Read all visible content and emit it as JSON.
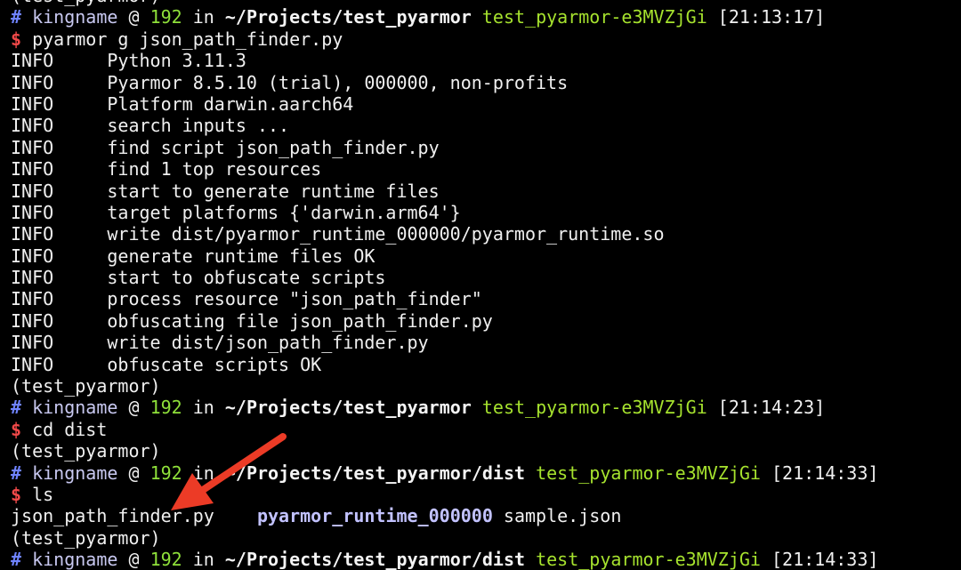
{
  "terminal": {
    "lines": [
      {
        "kind": "output",
        "text": "(test_pyarmor)"
      },
      {
        "kind": "prompt",
        "user": "kingname",
        "host": "192",
        "path": "~/Projects/test_pyarmor",
        "env": "test_pyarmor-e3MVZjGi",
        "time": "[21:13:17]"
      },
      {
        "kind": "command",
        "text": "pyarmor g json_path_finder.py"
      },
      {
        "kind": "output",
        "text": "INFO     Python 3.11.3"
      },
      {
        "kind": "output",
        "text": "INFO     Pyarmor 8.5.10 (trial), 000000, non-profits"
      },
      {
        "kind": "output",
        "text": "INFO     Platform darwin.aarch64"
      },
      {
        "kind": "output",
        "text": "INFO     search inputs ..."
      },
      {
        "kind": "output",
        "text": "INFO     find script json_path_finder.py"
      },
      {
        "kind": "output",
        "text": "INFO     find 1 top resources"
      },
      {
        "kind": "output",
        "text": "INFO     start to generate runtime files"
      },
      {
        "kind": "output",
        "text": "INFO     target platforms {'darwin.arm64'}"
      },
      {
        "kind": "output",
        "text": "INFO     write dist/pyarmor_runtime_000000/pyarmor_runtime.so"
      },
      {
        "kind": "output",
        "text": "INFO     generate runtime files OK"
      },
      {
        "kind": "output",
        "text": "INFO     start to obfuscate scripts"
      },
      {
        "kind": "output",
        "text": "INFO     process resource \"json_path_finder\""
      },
      {
        "kind": "output",
        "text": "INFO     obfuscating file json_path_finder.py"
      },
      {
        "kind": "output",
        "text": "INFO     write dist/json_path_finder.py"
      },
      {
        "kind": "output",
        "text": "INFO     obfuscate scripts OK"
      },
      {
        "kind": "output",
        "text": "(test_pyarmor)"
      },
      {
        "kind": "prompt",
        "user": "kingname",
        "host": "192",
        "path": "~/Projects/test_pyarmor",
        "env": "test_pyarmor-e3MVZjGi",
        "time": "[21:14:23]"
      },
      {
        "kind": "command",
        "text": "cd dist"
      },
      {
        "kind": "output",
        "text": "(test_pyarmor)"
      },
      {
        "kind": "prompt",
        "user": "kingname",
        "host": "192",
        "path": "~/Projects/test_pyarmor/dist",
        "env": "test_pyarmor-e3MVZjGi",
        "time": "[21:14:33]"
      },
      {
        "kind": "command",
        "text": "ls"
      },
      {
        "kind": "listing",
        "entries": [
          {
            "name": "json_path_finder.py",
            "type": "file",
            "pad": "    "
          },
          {
            "name": "pyarmor_runtime_000000",
            "type": "dir",
            "pad": " "
          },
          {
            "name": "sample.json",
            "type": "file",
            "pad": ""
          }
        ]
      },
      {
        "kind": "output",
        "text": "(test_pyarmor)"
      },
      {
        "kind": "prompt",
        "user": "kingname",
        "host": "192",
        "path": "~/Projects/test_pyarmor/dist",
        "env": "test_pyarmor-e3MVZjGi",
        "time": "[21:14:33]"
      }
    ],
    "prompt_symbols": {
      "hash": "#",
      "at": "@",
      "in": "in",
      "dollar": "$"
    }
  },
  "annotation": {
    "icon": "red-arrow-icon",
    "color": "#ec3b26"
  },
  "colors": {
    "background": "#000000",
    "text": "#f0f0f0",
    "hash": "#6f83ff",
    "host": "#8fe03a",
    "env": "#a6e22e",
    "dollar": "#f24949",
    "directory": "#c2c2ff"
  }
}
